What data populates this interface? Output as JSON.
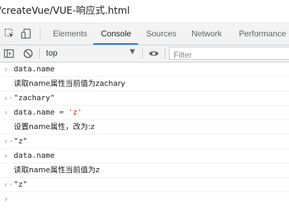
{
  "window": {
    "title": "/createVue/VUE-响应式.html"
  },
  "devtools": {
    "tabs": [
      "Elements",
      "Console",
      "Sources",
      "Network",
      "Performance"
    ],
    "active_tab": "Console",
    "icons": [
      "inspect-element-icon",
      "device-toolbar-icon"
    ]
  },
  "console_toolbar": {
    "context": "top",
    "filter_placeholder": "Filter",
    "icons": [
      "sidebar-toggle-icon",
      "clear-console-icon",
      "eye-icon"
    ]
  },
  "console": {
    "entries": [
      {
        "type": "input",
        "text": "data.name"
      },
      {
        "type": "log",
        "text": "读取name属性当前值为zachary"
      },
      {
        "type": "result",
        "text": "\"zachary\""
      },
      {
        "type": "input",
        "lhs": "data.name",
        "op": " = ",
        "rhs": "'z'"
      },
      {
        "type": "log",
        "text": "设置name属性，改为:z"
      },
      {
        "type": "result",
        "text": "\"z\""
      },
      {
        "type": "input",
        "text": "data.name"
      },
      {
        "type": "log",
        "text": "读取name属性当前值为z"
      },
      {
        "type": "result",
        "text": "\"z\""
      }
    ],
    "prompt_symbol": "›"
  },
  "colors": {
    "accent": "#1a73e8",
    "string": "#c41a16",
    "toolbar_bg": "#f3f3f3"
  }
}
